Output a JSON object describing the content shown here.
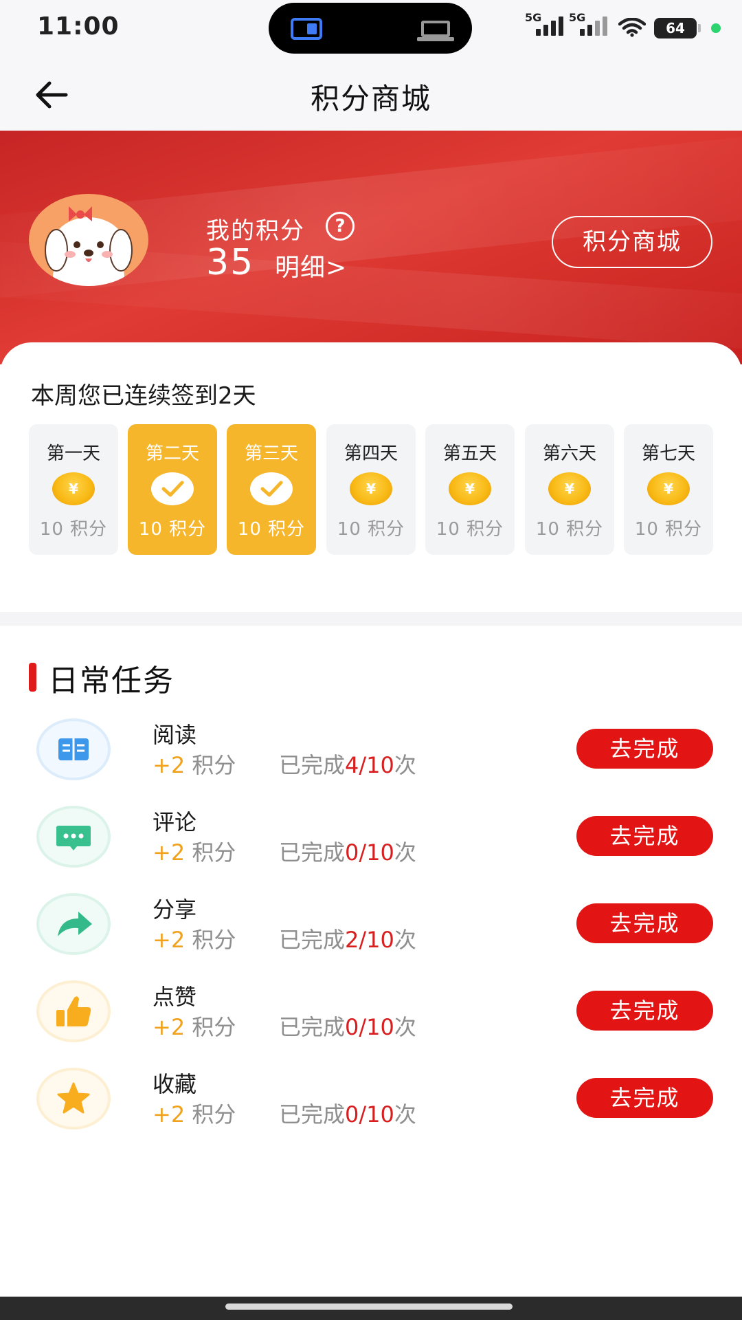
{
  "status_bar": {
    "time": "11:00",
    "signal1_label": "5G",
    "signal2_label": "5G",
    "battery": "64"
  },
  "nav": {
    "title": "积分商城"
  },
  "hero": {
    "points_label": "我的积分",
    "help_symbol": "?",
    "points_value": "35",
    "detail_link": "明细>",
    "mall_button": "积分商城"
  },
  "checkin": {
    "title": "本周您已连续签到2天",
    "coin_symbol": "¥",
    "days": [
      {
        "name": "第一天",
        "points": "10 积分",
        "done": false
      },
      {
        "name": "第二天",
        "points": "10 积分",
        "done": true
      },
      {
        "name": "第三天",
        "points": "10 积分",
        "done": true
      },
      {
        "name": "第四天",
        "points": "10 积分",
        "done": false
      },
      {
        "name": "第五天",
        "points": "10 积分",
        "done": false
      },
      {
        "name": "第六天",
        "points": "10 积分",
        "done": false
      },
      {
        "name": "第七天",
        "points": "10 积分",
        "done": false
      }
    ]
  },
  "tasks": {
    "title": "日常任务",
    "items": [
      {
        "name": "阅读",
        "plus": "+2",
        "unit": " 积分",
        "progress_prefix": "已完成",
        "count": "4/10",
        "progress_suffix": "次",
        "button": "去完成",
        "icon": "book-icon"
      },
      {
        "name": "评论",
        "plus": "+2",
        "unit": " 积分",
        "progress_prefix": "已完成",
        "count": "0/10",
        "progress_suffix": "次",
        "button": "去完成",
        "icon": "comment-icon"
      },
      {
        "name": "分享",
        "plus": "+2",
        "unit": " 积分",
        "progress_prefix": "已完成",
        "count": "2/10",
        "progress_suffix": "次",
        "button": "去完成",
        "icon": "share-icon"
      },
      {
        "name": "点赞",
        "plus": "+2",
        "unit": " 积分",
        "progress_prefix": "已完成",
        "count": "0/10",
        "progress_suffix": "次",
        "button": "去完成",
        "icon": "thumbs-up-icon"
      },
      {
        "name": "收藏",
        "plus": "+2",
        "unit": " 积分",
        "progress_prefix": "已完成",
        "count": "0/10",
        "progress_suffix": "次",
        "button": "去完成",
        "icon": "star-icon"
      }
    ]
  },
  "colors": {
    "brand_red": "#e21414",
    "checkin_done": "#f6b62c",
    "reward_orange": "#f0a21d"
  }
}
